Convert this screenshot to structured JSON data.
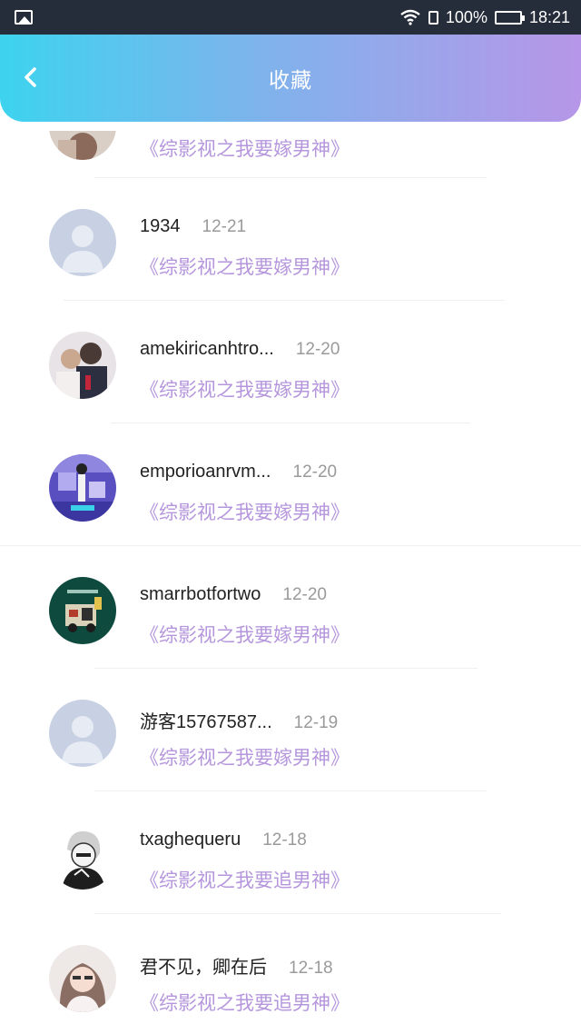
{
  "status_bar": {
    "signal": "",
    "battery": "100%",
    "time": "18:21"
  },
  "header": {
    "title": "收藏"
  },
  "items": [
    {
      "name": "",
      "date": "",
      "desc": "《综影视之我要嫁男神》"
    },
    {
      "name": "1934",
      "date": "12-21",
      "desc": "《综影视之我要嫁男神》"
    },
    {
      "name": "amekiricanhtro...",
      "date": "12-20",
      "desc": "《综影视之我要嫁男神》"
    },
    {
      "name": "emporioanrvm...",
      "date": "12-20",
      "desc": "《综影视之我要嫁男神》"
    },
    {
      "name": "smarrbotfortwo",
      "date": "12-20",
      "desc": "《综影视之我要嫁男神》"
    },
    {
      "name": "游客15767587...",
      "date": "12-19",
      "desc": "《综影视之我要嫁男神》"
    },
    {
      "name": "txaghequeru",
      "date": "12-18",
      "desc": "《综影视之我要追男神》"
    },
    {
      "name": "君不见，卿在后",
      "date": "12-18",
      "desc": "《综影视之我要追男神》"
    }
  ]
}
